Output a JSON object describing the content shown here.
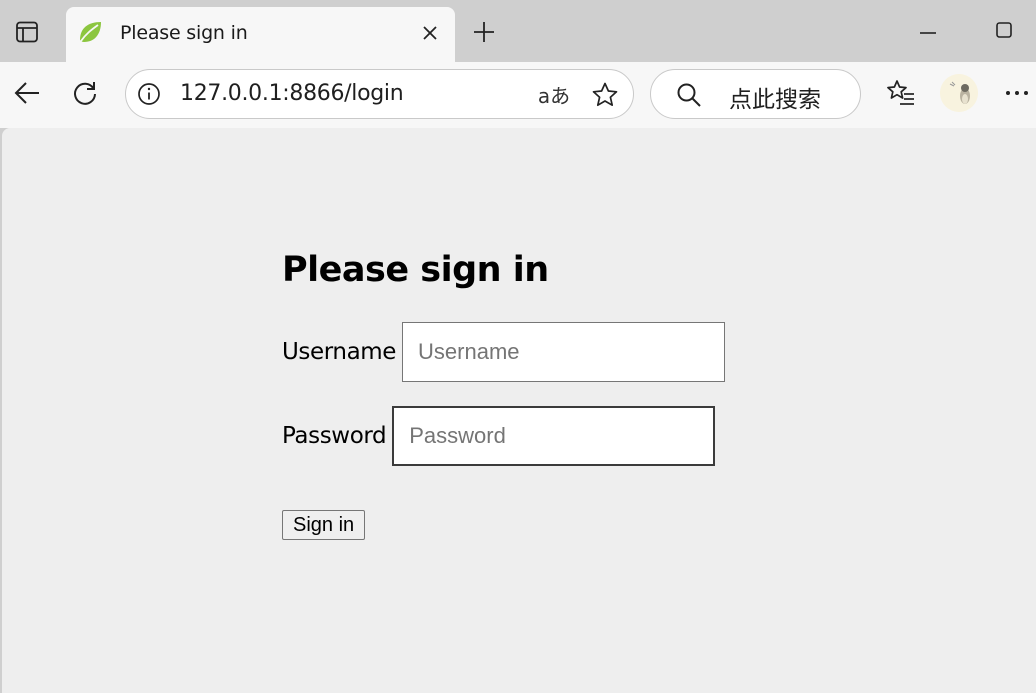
{
  "browser": {
    "tab": {
      "title": "Please sign in",
      "favicon": "spring-leaf-icon"
    },
    "address_bar": {
      "url": "127.0.0.1:8866/login",
      "translate_label": "aあ"
    },
    "search": {
      "placeholder": "点此搜索"
    }
  },
  "page": {
    "heading": "Please sign in",
    "username": {
      "label": "Username",
      "placeholder": "Username"
    },
    "password": {
      "label": "Password",
      "placeholder": "Password"
    },
    "submit_label": "Sign in"
  },
  "colors": {
    "page_bg": "#eeeeee",
    "chrome_bg": "#cfcfcf",
    "toolbar_bg": "#f7f7f7",
    "favicon": "#8cc63f"
  }
}
